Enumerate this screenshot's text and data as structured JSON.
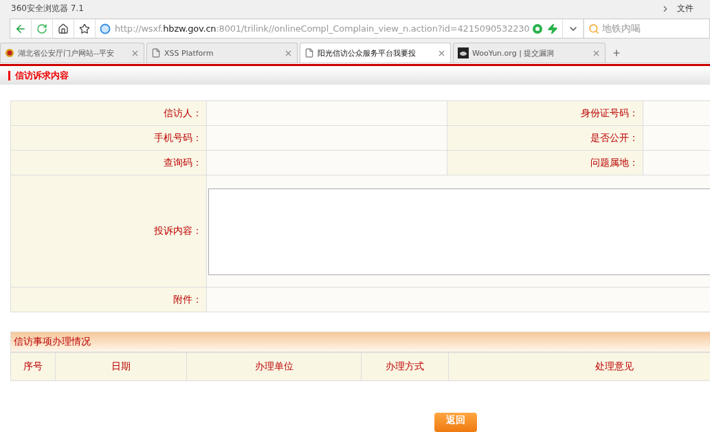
{
  "window": {
    "title": "360安全浏览器 7.1",
    "menu": [
      "文件"
    ]
  },
  "address_bar": {
    "url_prefix": "http://wsxf.",
    "url_host": "hbzw.gov.cn",
    "url_rest": ":8001/trilink//onlineCompl_Complain_view_n.action?id=4215090532230",
    "search_placeholder": "地铁内喝"
  },
  "tabs": [
    {
      "label": "湖北省公安厅门户网站--平安",
      "selected": false,
      "kind": "badge"
    },
    {
      "label": "XSS Platform",
      "selected": false,
      "kind": "page"
    },
    {
      "label": "阳光信访公众服务平台我要投",
      "selected": true,
      "kind": "page"
    },
    {
      "label": "WooYun.org | 提交漏洞",
      "selected": false,
      "kind": "cloud"
    }
  ],
  "section_title": "信访诉求内容",
  "form": {
    "rows": [
      {
        "label_1": "信访人：",
        "label_2": "身份证号码："
      },
      {
        "label_1": "手机号码：",
        "label_2": "是否公开："
      },
      {
        "label_1": "查询码：",
        "label_2": "问题属地："
      }
    ],
    "complaint_label": "投诉内容：",
    "attachment_label": "附件："
  },
  "handling": {
    "title": "信访事项办理情况",
    "columns": [
      "序号",
      "日期",
      "办理单位",
      "办理方式",
      "处理意见"
    ]
  },
  "back_button": "返回"
}
